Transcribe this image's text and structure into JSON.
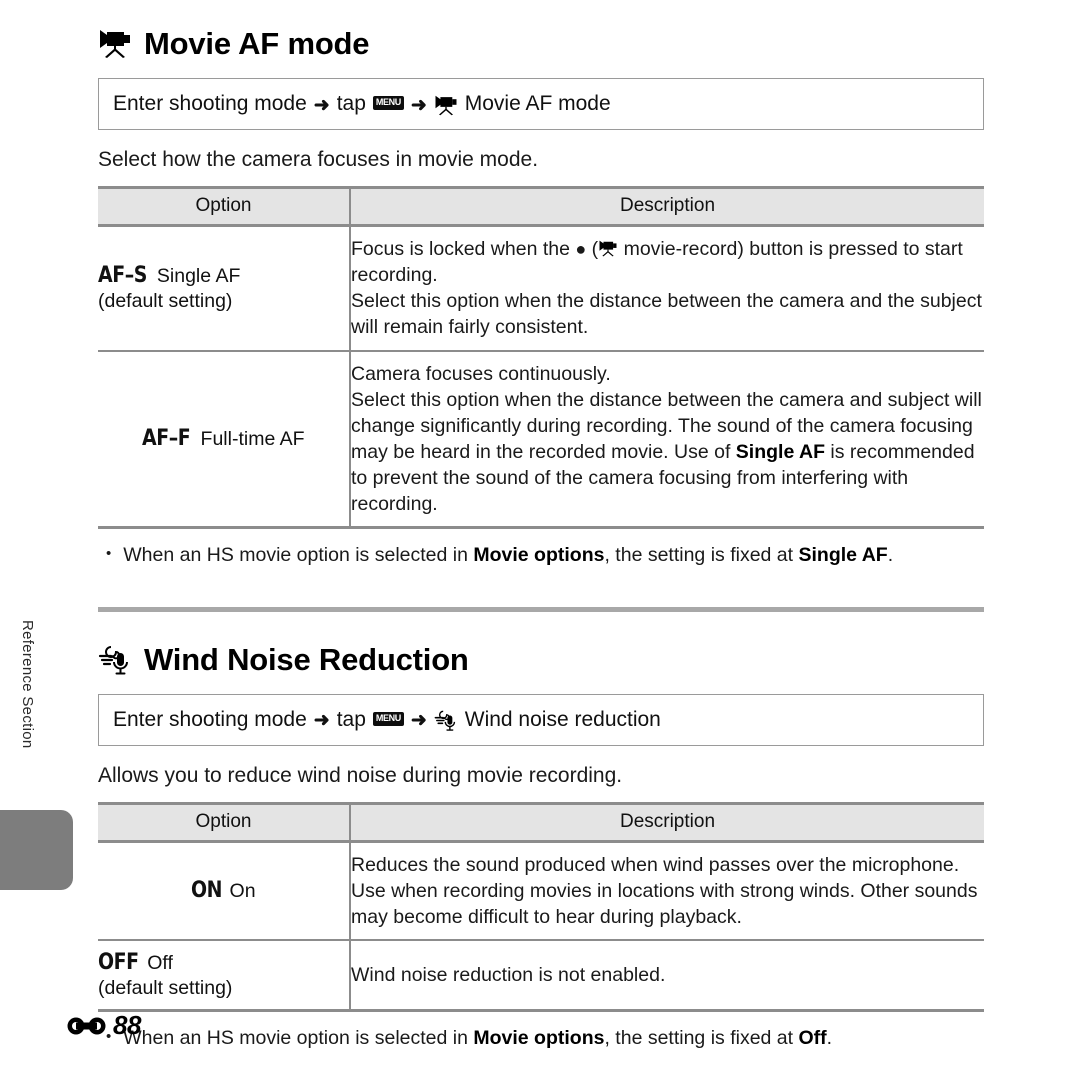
{
  "sidebar": {
    "tab_label": "Reference Section"
  },
  "footer": {
    "ref_symbol_name": "reference-section-symbol",
    "page_number": "88"
  },
  "sections": [
    {
      "id": "movie-af-mode",
      "icon": "movie-camera-icon",
      "heading": "Movie AF mode",
      "nav": {
        "part1": "Enter shooting mode",
        "arrow1": "➜",
        "part2": "tap",
        "menu_icon_label": "MENU",
        "arrow2": "➜",
        "trailing_icon": "movie-camera-icon",
        "part3": "Movie AF mode"
      },
      "intro": "Select how the camera focuses in movie mode.",
      "table": {
        "headers": [
          "Option",
          "Description"
        ],
        "rows": [
          {
            "option_code": "AF–S",
            "option_label": "Single AF",
            "option_sub": "(default setting)",
            "description_html": "Focus is locked when the ● (▶ movie-record) button is pressed to start recording.<br>Select this option when the distance between the camera and the subject will remain fairly consistent.",
            "description_plain": "Focus is locked when the (movie-record) button is pressed to start recording. Select this option when the distance between the camera and the subject will remain fairly consistent."
          },
          {
            "option_code": "AF–F",
            "option_label": "Full-time AF",
            "option_sub": "",
            "description_html": "Camera focuses continuously.<br>Select this option when the distance between the camera and subject will change significantly during recording. The sound of the camera focusing may be heard in the recorded movie. Use of <b>Single AF</b> is recommended to prevent the sound of the camera focusing from interfering with recording.",
            "description_plain": "Camera focuses continuously. Select this option when the distance between the camera and subject will change significantly during recording. The sound of the camera focusing may be heard in the recorded movie. Use of Single AF is recommended to prevent the sound of the camera focusing from interfering with recording."
          }
        ]
      },
      "note_html": "When an HS movie option is selected in <b>Movie options</b>, the setting is fixed at <b>Single AF</b>.",
      "note_plain": "When an HS movie option is selected in Movie options, the setting is fixed at Single AF.",
      "bullet": "•"
    },
    {
      "id": "wind-noise-reduction",
      "icon": "wind-noise-icon",
      "heading": "Wind Noise Reduction",
      "nav": {
        "part1": "Enter shooting mode",
        "arrow1": "➜",
        "part2": "tap",
        "menu_icon_label": "MENU",
        "arrow2": "➜",
        "trailing_icon": "wind-noise-icon",
        "part3": "Wind noise reduction"
      },
      "intro": "Allows you to reduce wind noise during movie recording.",
      "table": {
        "headers": [
          "Option",
          "Description"
        ],
        "rows": [
          {
            "option_code": "ON",
            "option_label": "On",
            "option_sub": "",
            "description_html": "Reduces the sound produced when wind passes over the microphone. Use when recording movies in locations with strong winds. Other sounds may become difficult to hear during playback.",
            "description_plain": "Reduces the sound produced when wind passes over the microphone. Use when recording movies in locations with strong winds. Other sounds may become difficult to hear during playback."
          },
          {
            "option_code": "OFF",
            "option_label": "Off",
            "option_sub": "(default setting)",
            "description_html": "Wind noise reduction is not enabled.",
            "description_plain": "Wind noise reduction is not enabled."
          }
        ]
      },
      "note_html": "When an HS movie option is selected in <b>Movie options</b>, the setting is fixed at <b>Off</b>.",
      "note_plain": "When an HS movie option is selected in Movie options, the setting is fixed at Off.",
      "bullet": "•"
    }
  ],
  "colors": {
    "rule": "#8c8c8c",
    "header_bg": "#e4e4e4",
    "tab_gray": "#7d7d7d",
    "divider": "#a8a8a8",
    "text": "#1a1a1a"
  }
}
